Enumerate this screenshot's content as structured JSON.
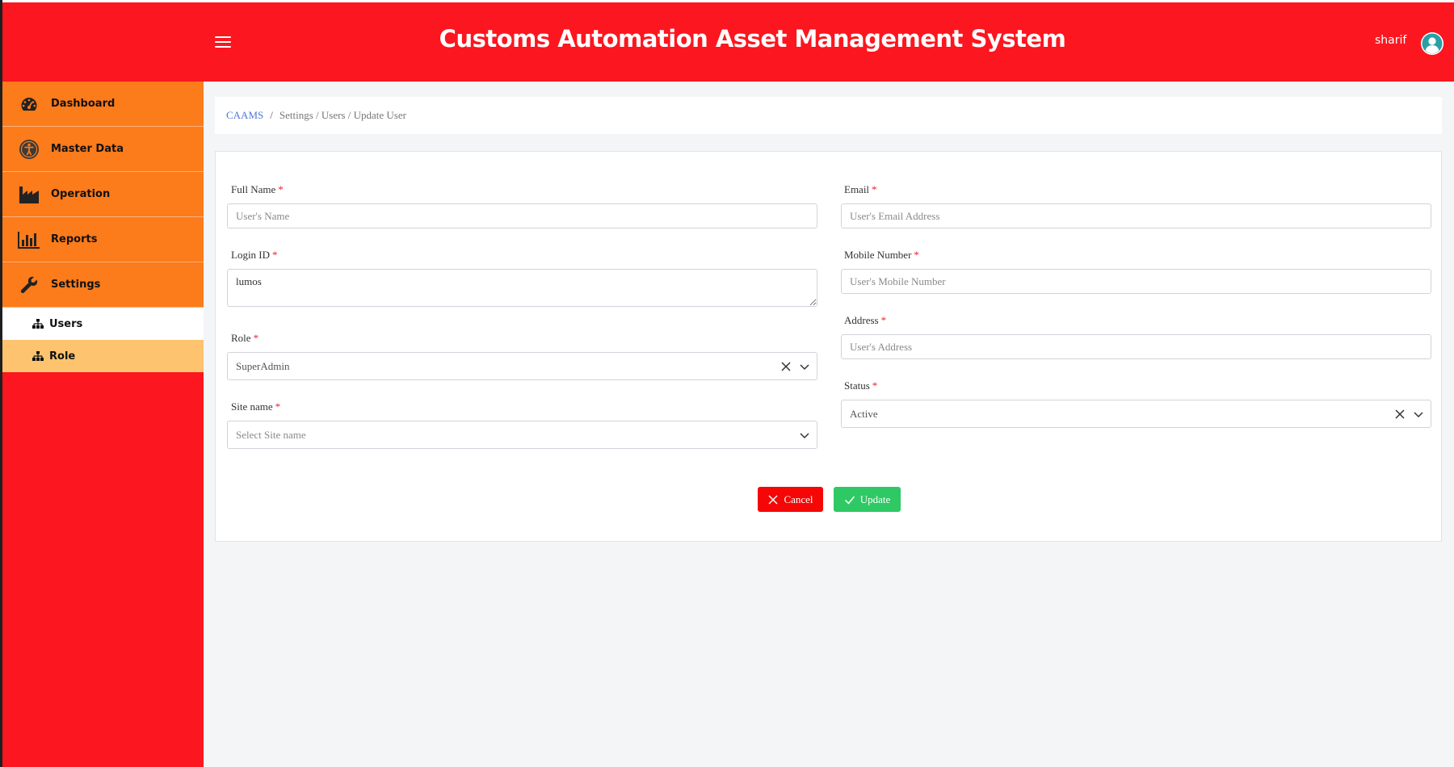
{
  "header": {
    "title": "Customs Automation Asset Management System",
    "username": "sharif"
  },
  "sidebar": {
    "items": [
      {
        "label": "Dashboard",
        "icon": "dashboard-gauge-icon"
      },
      {
        "label": "Master Data",
        "icon": "accessibility-icon"
      },
      {
        "label": "Operation",
        "icon": "factory-icon"
      },
      {
        "label": "Reports",
        "icon": "bar-chart-icon"
      },
      {
        "label": "Settings",
        "icon": "wrench-icon"
      }
    ],
    "sub_items": [
      {
        "label": "Users",
        "icon": "sitemap-icon",
        "active": true
      },
      {
        "label": "Role",
        "icon": "sitemap-icon",
        "active": false
      }
    ]
  },
  "breadcrumb": {
    "root": "CAAMS",
    "separator": "/",
    "path": "Settings / Users / Update User"
  },
  "form": {
    "full_name": {
      "label": "Full Name",
      "required": "*",
      "placeholder": "User's Name",
      "value": ""
    },
    "login_id": {
      "label": "Login ID",
      "required": "*",
      "value": "lumos"
    },
    "role": {
      "label": "Role",
      "required": "*",
      "value": "SuperAdmin"
    },
    "site_name": {
      "label": "Site name",
      "required": "*",
      "placeholder": "Select Site name"
    },
    "email": {
      "label": "Email",
      "required": "*",
      "placeholder": "User's Email Address",
      "value": ""
    },
    "mobile": {
      "label": "Mobile Number",
      "required": "*",
      "placeholder": "User's Mobile Number",
      "value": ""
    },
    "address": {
      "label": "Address",
      "required": "*",
      "placeholder": "User's Address",
      "value": ""
    },
    "status": {
      "label": "Status",
      "required": "*",
      "value": "Active"
    }
  },
  "actions": {
    "cancel_label": "Cancel",
    "update_label": "Update"
  },
  "colors": {
    "header_bg": "#fc161f",
    "nav_item_bg": "#fc7b1b",
    "sub_item_alt_bg": "#fdc36e",
    "cancel_bg": "#f50707",
    "update_bg": "#2ec964",
    "link": "#4f78d6"
  }
}
